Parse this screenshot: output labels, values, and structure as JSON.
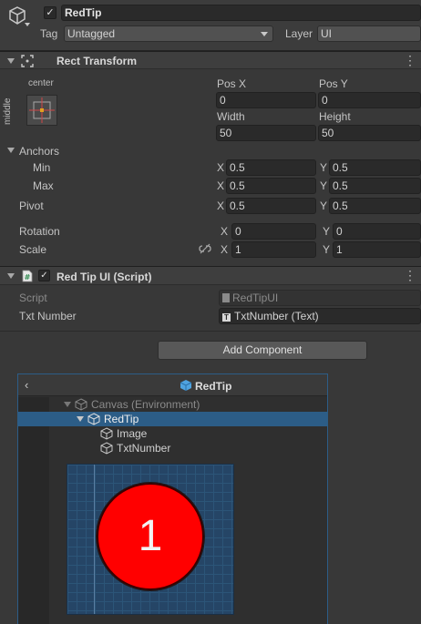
{
  "header": {
    "name": "RedTip",
    "tag_label": "Tag",
    "tag_value": "Untagged",
    "layer_label": "Layer",
    "layer_value": "UI"
  },
  "rect_transform": {
    "title": "Rect Transform",
    "anchor_preset_h": "center",
    "anchor_preset_v": "middle",
    "pos_x_label": "Pos X",
    "pos_y_label": "Pos Y",
    "pos_x": "0",
    "pos_y": "0",
    "width_label": "Width",
    "height_label": "Height",
    "width": "50",
    "height": "50",
    "anchors_label": "Anchors",
    "min_label": "Min",
    "max_label": "Max",
    "min_x": "0.5",
    "min_y": "0.5",
    "max_x": "0.5",
    "max_y": "0.5",
    "pivot_label": "Pivot",
    "pivot_x": "0.5",
    "pivot_y": "0.5",
    "rotation_label": "Rotation",
    "rot_x": "0",
    "rot_y": "0",
    "scale_label": "Scale",
    "scale_x": "1",
    "scale_y": "1",
    "x_axis": "X",
    "y_axis": "Y"
  },
  "script_component": {
    "title": "Red Tip UI (Script)",
    "script_label": "Script",
    "script_value": "RedTipUI",
    "txt_number_label": "Txt Number",
    "txt_number_value": "TxtNumber (Text)"
  },
  "add_component_label": "Add Component",
  "prefab_panel": {
    "title": "RedTip",
    "hierarchy": [
      {
        "label": "Canvas (Environment)"
      },
      {
        "label": "RedTip"
      },
      {
        "label": "Image"
      },
      {
        "label": "TxtNumber"
      }
    ],
    "preview_number": "1"
  },
  "colors": {
    "accent_selection": "#2c5d87",
    "badge_red": "#ff0000"
  }
}
